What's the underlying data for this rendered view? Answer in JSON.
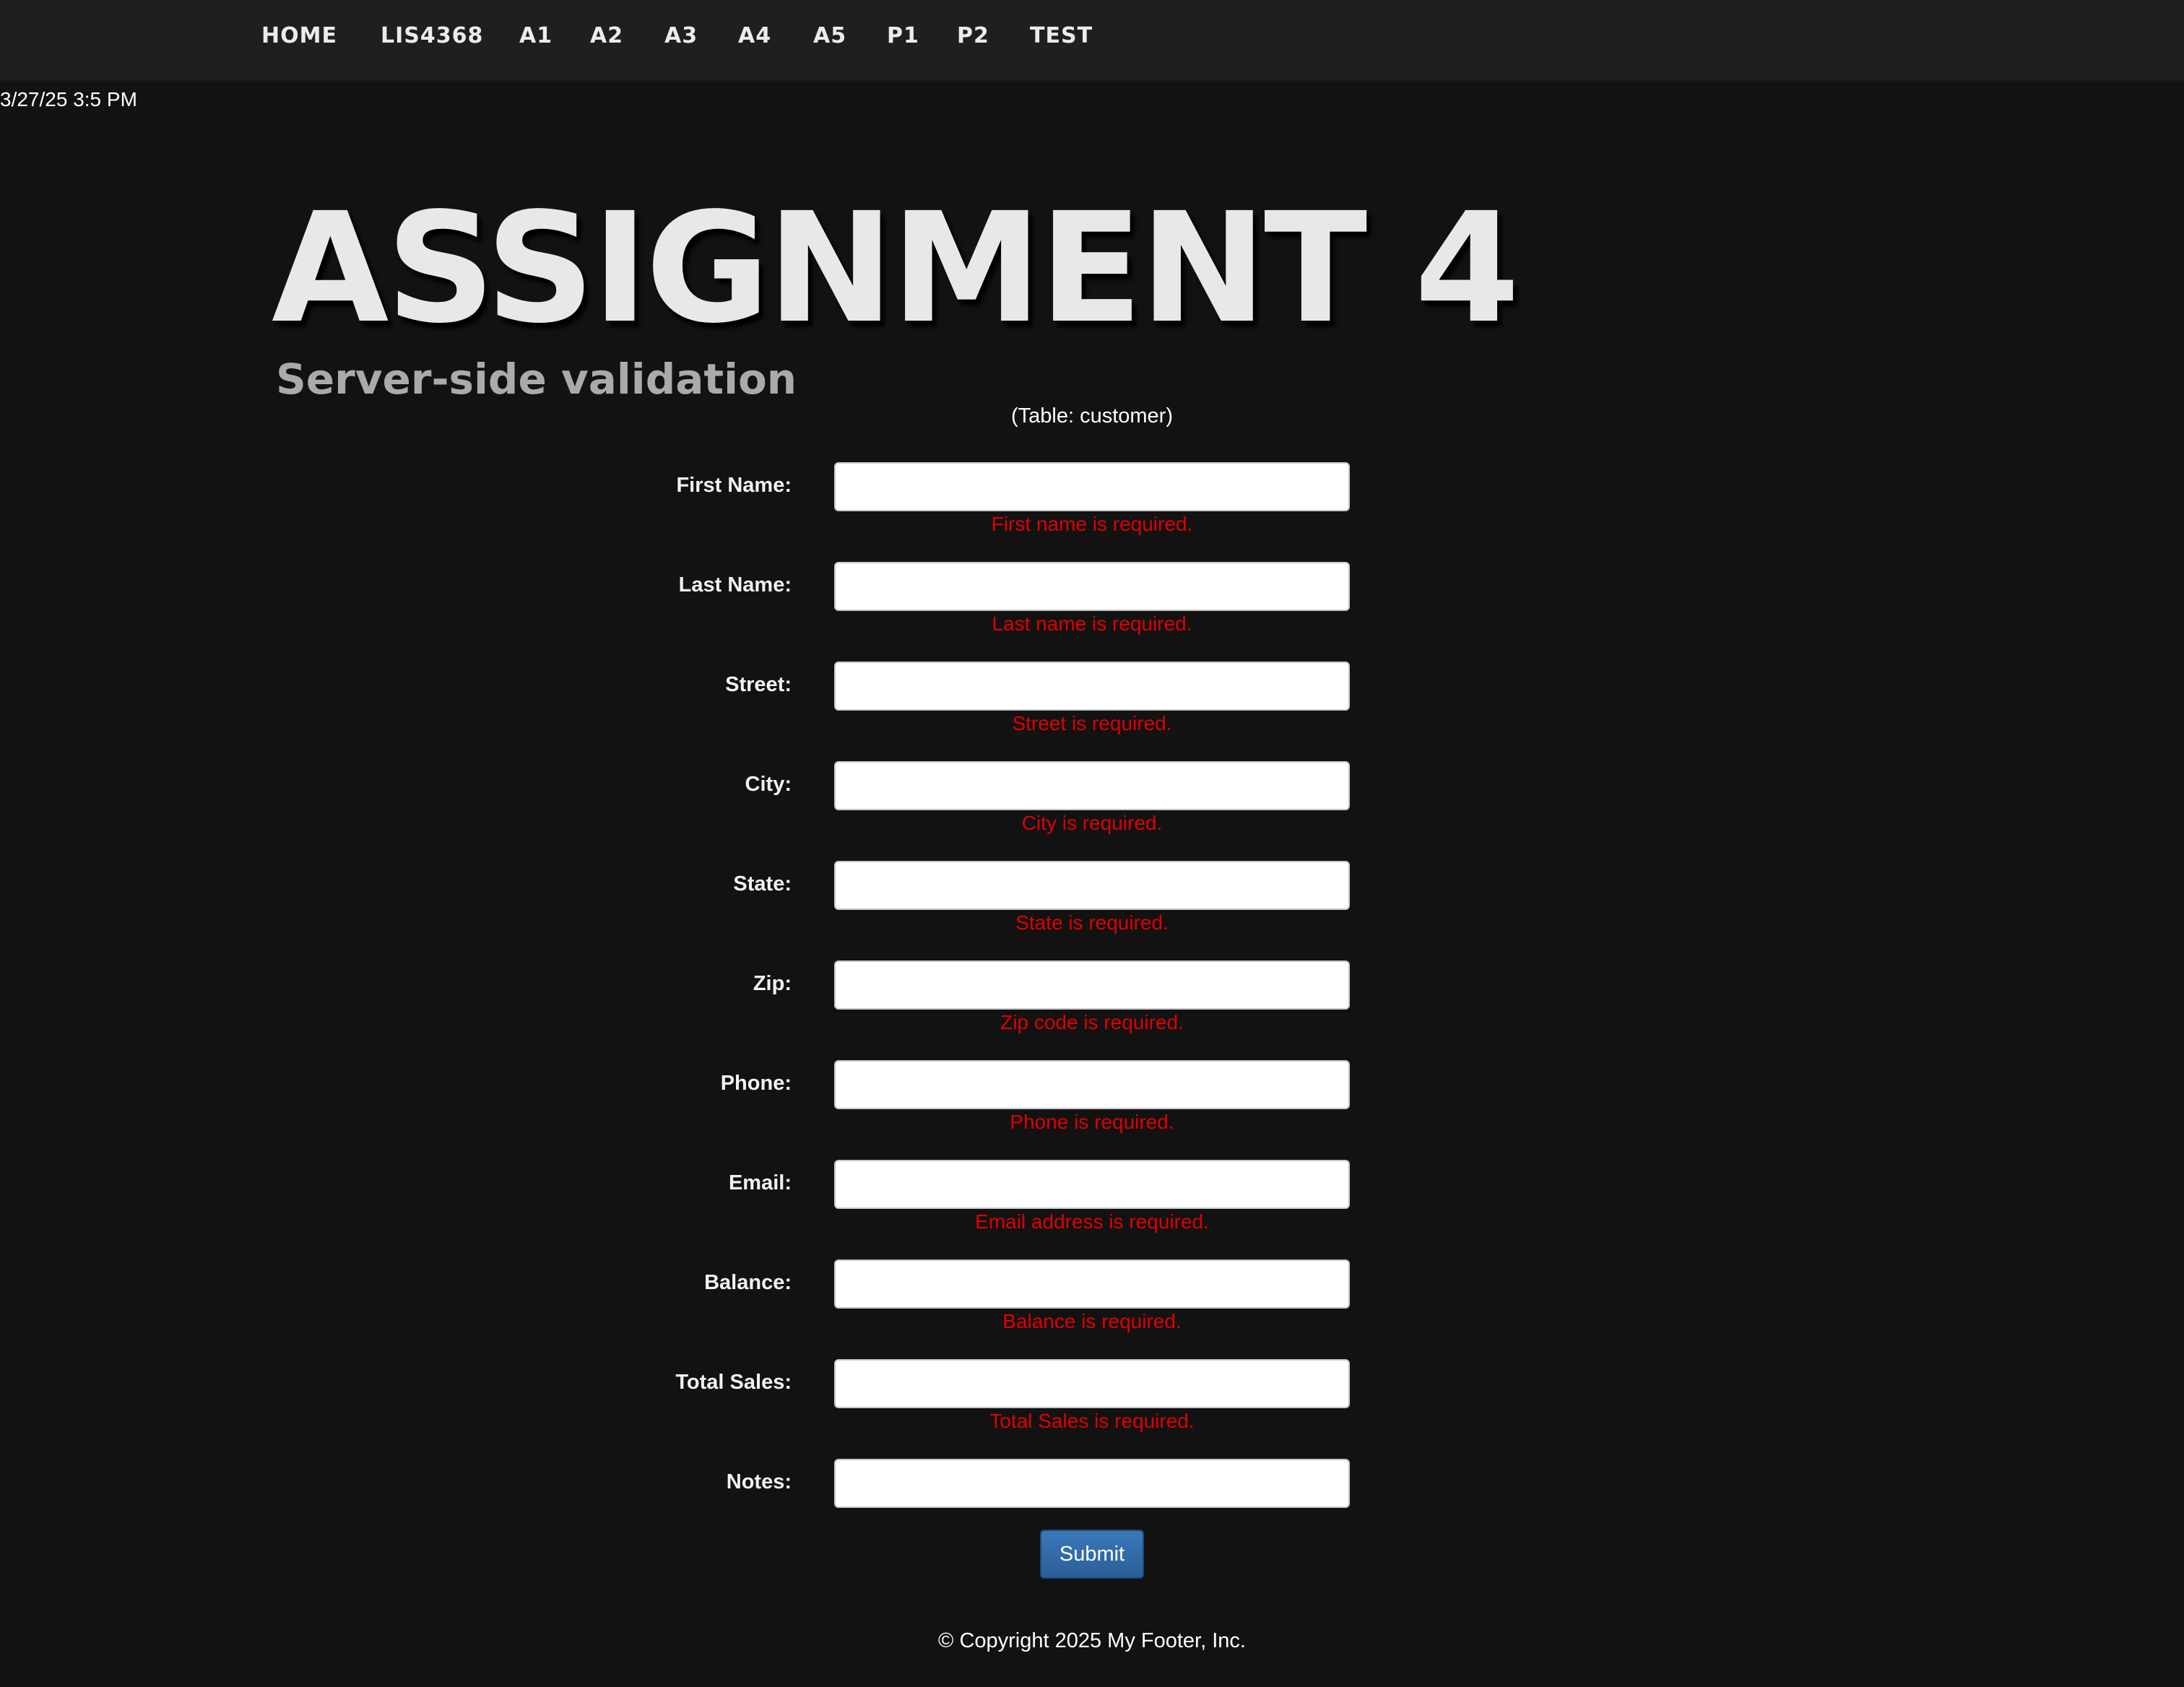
{
  "nav": {
    "items": [
      {
        "label": "HOME"
      },
      {
        "label": "LIS4368"
      },
      {
        "label": "A1"
      },
      {
        "label": "A2"
      },
      {
        "label": "A3"
      },
      {
        "label": "A4"
      },
      {
        "label": "A5"
      },
      {
        "label": "P1"
      },
      {
        "label": "P2"
      },
      {
        "label": "TEST"
      }
    ]
  },
  "datetime": "3/27/25 3:5 PM",
  "header": {
    "title": "ASSIGNMENT 4",
    "subtitle": "Server-side validation"
  },
  "form": {
    "table_note": "(Table: customer)",
    "fields": [
      {
        "label": "First Name:",
        "value": "",
        "error": "First name is required."
      },
      {
        "label": "Last Name:",
        "value": "",
        "error": "Last name is required."
      },
      {
        "label": "Street:",
        "value": "",
        "error": "Street is required."
      },
      {
        "label": "City:",
        "value": "",
        "error": "City is required."
      },
      {
        "label": "State:",
        "value": "",
        "error": "State is required."
      },
      {
        "label": "Zip:",
        "value": "",
        "error": "Zip code is required."
      },
      {
        "label": "Phone:",
        "value": "",
        "error": "Phone is required."
      },
      {
        "label": "Email:",
        "value": "",
        "error": "Email address is required."
      },
      {
        "label": "Balance:",
        "value": "",
        "error": "Balance is required."
      },
      {
        "label": "Total Sales:",
        "value": "",
        "error": "Total Sales is required."
      },
      {
        "label": "Notes:",
        "value": "",
        "error": ""
      }
    ],
    "submit_label": "Submit"
  },
  "footer": {
    "text": "© Copyright 2025 My Footer, Inc."
  },
  "colors": {
    "background": "#121212",
    "navbar": "#1f1f1f",
    "error": "#e00000",
    "submit": "#2a5f99",
    "subtitle": "#aaaaaa"
  }
}
